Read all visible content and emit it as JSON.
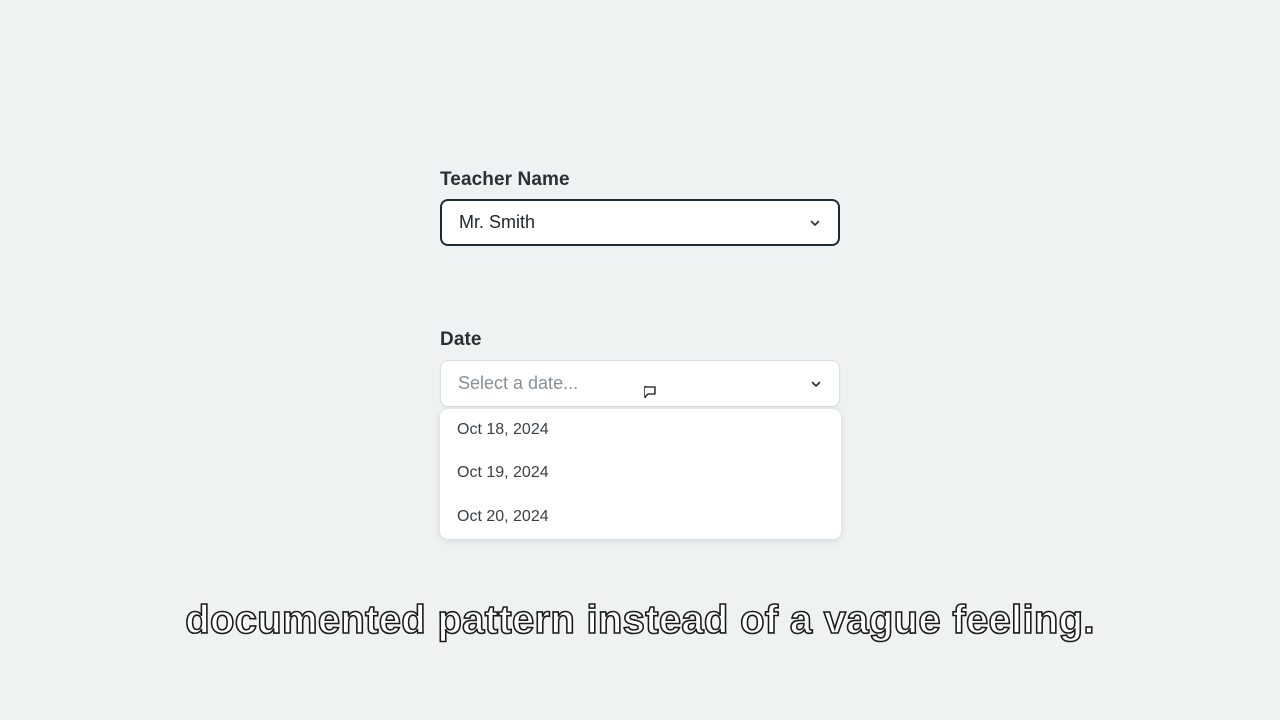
{
  "teacher": {
    "label": "Teacher Name",
    "value": "Mr. Smith"
  },
  "date": {
    "label": "Date",
    "placeholder": "Select a date...",
    "options": [
      "Oct 18, 2024",
      "Oct 19, 2024",
      "Oct 20, 2024"
    ]
  },
  "caption": "documented pattern instead of a vague feeling."
}
